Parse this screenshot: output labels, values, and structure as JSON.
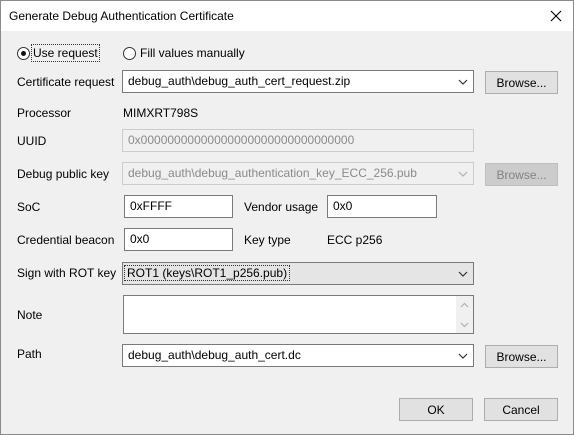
{
  "window": {
    "title": "Generate Debug Authentication Certificate"
  },
  "mode": {
    "use_request_label": "Use request",
    "fill_manual_label": "Fill values manually",
    "selected": "use_request"
  },
  "certificate_request": {
    "label": "Certificate request",
    "value": "debug_auth\\debug_auth_cert_request.zip",
    "browse_label": "Browse..."
  },
  "processor": {
    "label": "Processor",
    "value": "MIMXRT798S"
  },
  "uuid": {
    "label": "UUID",
    "value": "0x00000000000000000000000000000000"
  },
  "debug_public_key": {
    "label": "Debug public key",
    "value": "debug_auth\\debug_authentication_key_ECC_256.pub",
    "browse_label": "Browse..."
  },
  "soc": {
    "label": "SoC",
    "value": "0xFFFF"
  },
  "vendor_usage": {
    "label": "Vendor usage",
    "value": "0x0"
  },
  "credential_beacon": {
    "label": "Credential beacon",
    "value": "0x0"
  },
  "key_type": {
    "label": "Key type",
    "value": "ECC p256"
  },
  "sign_with_rot_key": {
    "label": "Sign with ROT key",
    "value": "ROT1 (keys\\ROT1_p256.pub)"
  },
  "note": {
    "label": "Note",
    "value": ""
  },
  "path": {
    "label": "Path",
    "value": "debug_auth\\debug_auth_cert.dc",
    "browse_label": "Browse..."
  },
  "buttons": {
    "ok_label": "OK",
    "cancel_label": "Cancel"
  }
}
